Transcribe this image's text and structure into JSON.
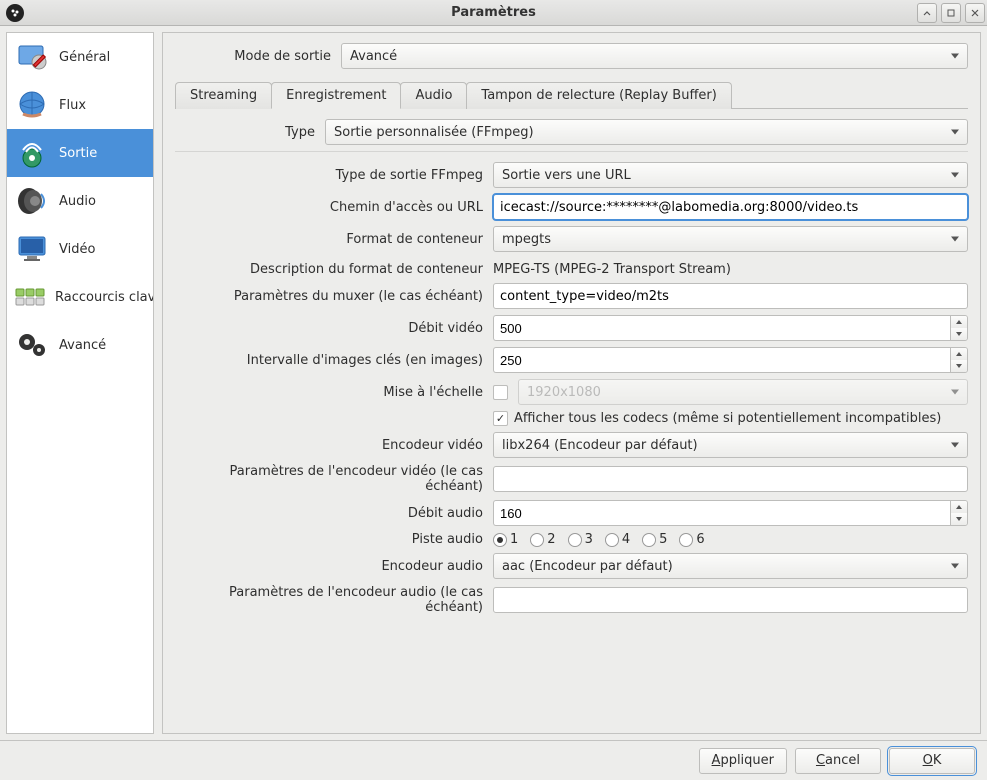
{
  "window": {
    "title": "Paramètres"
  },
  "sidebar": {
    "items": [
      {
        "label": "Général"
      },
      {
        "label": "Flux"
      },
      {
        "label": "Sortie"
      },
      {
        "label": "Audio"
      },
      {
        "label": "Vidéo"
      },
      {
        "label": "Raccourcis clavier"
      },
      {
        "label": "Avancé"
      }
    ],
    "selected_index": 2
  },
  "output_mode": {
    "label": "Mode de sortie",
    "value": "Avancé"
  },
  "tabs": {
    "items": [
      {
        "label": "Streaming"
      },
      {
        "label": "Enregistrement"
      },
      {
        "label": "Audio"
      },
      {
        "label": "Tampon de relecture (Replay Buffer)"
      }
    ],
    "active_index": 1
  },
  "type_row": {
    "label": "Type",
    "value": "Sortie personnalisée (FFmpeg)"
  },
  "ffmpeg": {
    "output_type": {
      "label": "Type de sortie FFmpeg",
      "value": "Sortie vers une URL"
    },
    "url": {
      "label": "Chemin d'accès ou URL",
      "value": "icecast://source:********@labomedia.org:8000/video.ts"
    },
    "container": {
      "label": "Format de conteneur",
      "value": "mpegts"
    },
    "container_desc": {
      "label": "Description du format de conteneur",
      "value": "MPEG-TS (MPEG-2 Transport Stream)"
    },
    "muxer": {
      "label": "Paramètres du muxer (le cas échéant)",
      "value": "content_type=video/m2ts"
    },
    "video_bitrate": {
      "label": "Débit vidéo",
      "value": "500"
    },
    "keyframe": {
      "label": "Intervalle d'images clés (en images)",
      "value": "250"
    },
    "rescale": {
      "label": "Mise à l'échelle",
      "checked": false,
      "placeholder": "1920x1080"
    },
    "show_all_codecs": {
      "label": "Afficher tous les codecs (même si potentiellement incompatibles)",
      "checked": true
    },
    "video_encoder": {
      "label": "Encodeur vidéo",
      "value": "libx264 (Encodeur par défaut)"
    },
    "video_enc_params": {
      "label": "Paramètres de l'encodeur vidéo (le cas échéant)",
      "value": ""
    },
    "audio_bitrate": {
      "label": "Débit audio",
      "value": "160"
    },
    "audio_track": {
      "label": "Piste audio",
      "options": [
        "1",
        "2",
        "3",
        "4",
        "5",
        "6"
      ],
      "selected": "1"
    },
    "audio_encoder": {
      "label": "Encodeur audio",
      "value": "aac (Encodeur par défaut)"
    },
    "audio_enc_params": {
      "label": "Paramètres de l'encodeur audio (le cas échéant)",
      "value": ""
    }
  },
  "footer": {
    "apply": "Appliquer",
    "cancel": "Cancel",
    "ok": "OK"
  }
}
